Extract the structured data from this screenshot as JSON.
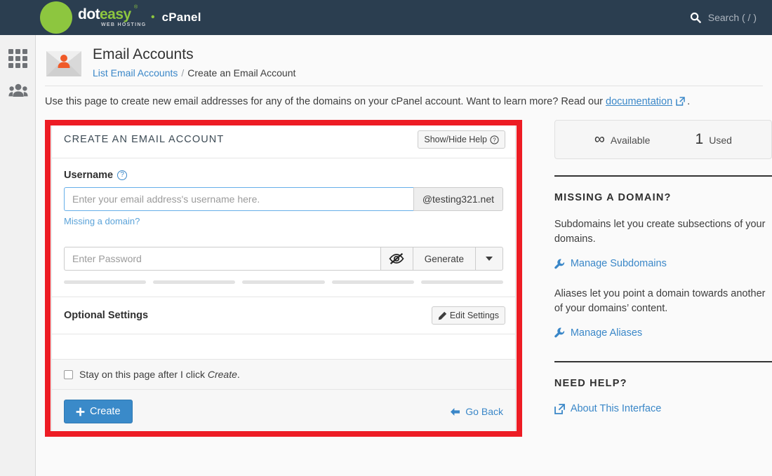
{
  "topnav": {
    "logo_dot": "dot",
    "logo_easy": "easy",
    "logo_reg": "®",
    "logo_sub": "WEB HOSTING",
    "separator": "•",
    "title": "cPanel",
    "search_placeholder": "Search ( / )"
  },
  "leftrail": {
    "items": [
      {
        "name": "apps-grid",
        "icon": "grid-icon"
      },
      {
        "name": "user-manager",
        "icon": "users-icon"
      }
    ]
  },
  "header": {
    "title": "Email Accounts",
    "icon": "email-account-icon",
    "breadcrumb": {
      "link": "List Email Accounts",
      "separator": "/",
      "current": "Create an Email Account"
    },
    "description_before": "Use this page to create new email addresses for any of the domains on your cPanel account. Want to learn more? Read our ",
    "description_link": "documentation",
    "description_after": "."
  },
  "card": {
    "title": "CREATE AN EMAIL ACCOUNT",
    "help_button": "Show/Hide Help",
    "help_button_icon": "question-circle-icon",
    "username": {
      "label": "Username",
      "help_icon": "question-circle-icon",
      "placeholder": "Enter your email address's username here.",
      "value": "",
      "domain_addon": "@testing321.net",
      "missing_domain_link": "Missing a domain?"
    },
    "password": {
      "placeholder": "Enter Password",
      "value": "",
      "toggle_icon": "eye-slash-icon",
      "generate_label": "Generate",
      "caret_icon": "chevron-down-icon",
      "strength_segments": 5
    },
    "optional": {
      "title": "Optional Settings",
      "edit_label": "Edit Settings",
      "edit_icon": "pencil-icon"
    },
    "stay_checkbox": {
      "checked": false,
      "text_before": "Stay on this page after I click ",
      "text_em": "Create",
      "text_after": "."
    },
    "footer": {
      "create_label": "Create",
      "create_icon": "plus-icon",
      "go_back_label": "Go Back",
      "go_back_icon": "arrow-left-icon"
    }
  },
  "sidebar": {
    "quota": {
      "available_value": "∞",
      "available_label": "Available",
      "used_value": "1",
      "used_label": "Used"
    },
    "missing_domain": {
      "heading": "MISSING A DOMAIN?",
      "subdomain_text": "Subdomains let you create subsections of your domains.",
      "subdomain_link": "Manage Subdomains",
      "subdomain_icon": "wrench-icon",
      "alias_text": "Aliases let you point a domain towards another of your domains’ content.",
      "alias_link": "Manage Aliases",
      "alias_icon": "wrench-icon"
    },
    "need_help": {
      "heading": "NEED HELP?",
      "link": "About This Interface",
      "icon": "external-link-icon"
    }
  },
  "annotation": {
    "highlight_color": "#ED1C24"
  }
}
